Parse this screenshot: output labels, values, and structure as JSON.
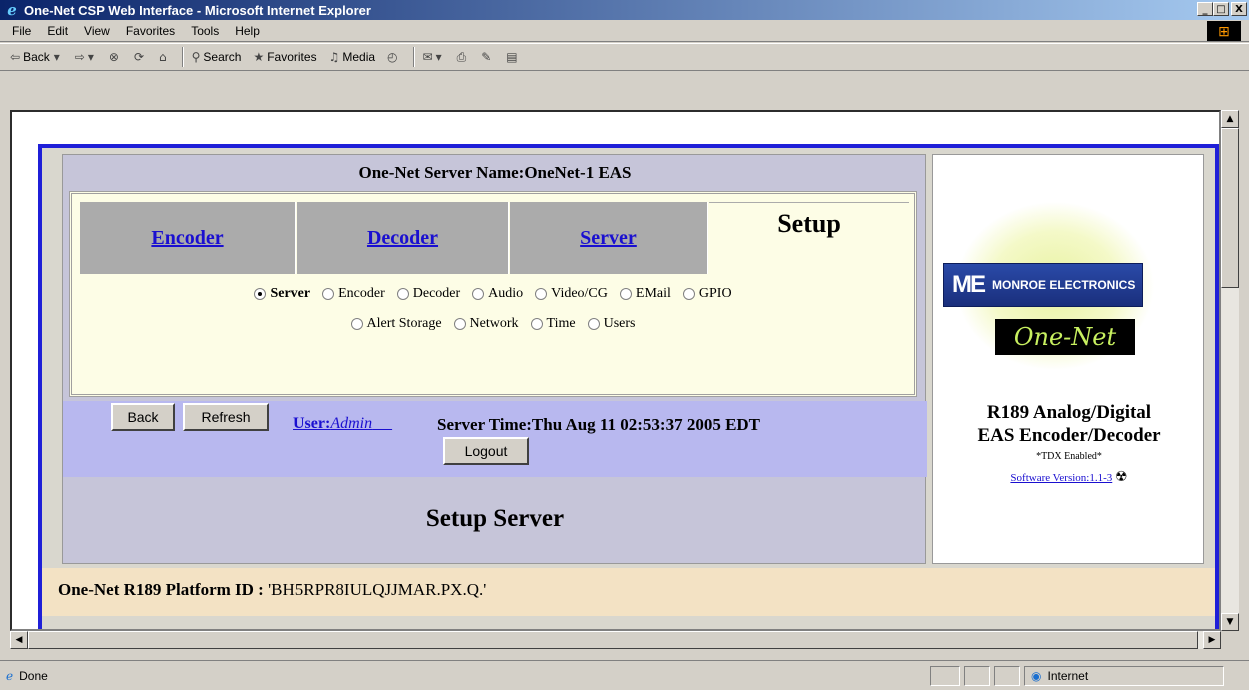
{
  "window": {
    "title": "One-Net CSP Web Interface - Microsoft Internet Explorer",
    "min": "_",
    "max": "□",
    "close": "X"
  },
  "menu": [
    "File",
    "Edit",
    "View",
    "Favorites",
    "Tools",
    "Help"
  ],
  "toolbar": {
    "back": "Back",
    "search": "Search",
    "favorites": "Favorites",
    "media": "Media"
  },
  "page": {
    "server_name": "One-Net Server Name:OneNet-1 EAS",
    "tabs": [
      "Encoder",
      "Decoder",
      "Server"
    ],
    "active_tab": "Setup",
    "radios_row1": [
      "Server",
      "Encoder",
      "Decoder",
      "Audio",
      "Video/CG",
      "EMail",
      "GPIO"
    ],
    "radios_row2": [
      "Alert Storage",
      "Network",
      "Time",
      "Users"
    ],
    "selected_radio": "Server",
    "back_button": "Back",
    "refresh_button": "Refresh",
    "user_label": "User:",
    "user_name": "Admin",
    "server_time": "Server Time:Thu Aug 11 02:53:37 2005 EDT",
    "logout_button": "Logout",
    "heading": "Setup Server",
    "platform_label": "One-Net R189 Platform ID :",
    "platform_id": "'BH5RPR8IULQJJMAR.PX.Q.'"
  },
  "sidebar": {
    "logo_company": "MONROE ELECTRONICS",
    "logo_product": "One-Net",
    "product_line1": "R189 Analog/Digital",
    "product_line2": "EAS Encoder/Decoder",
    "tdx": "*TDX Enabled*",
    "software_version": "Software Version:1.1-3"
  },
  "status": {
    "text": "Done",
    "zone": "Internet"
  }
}
